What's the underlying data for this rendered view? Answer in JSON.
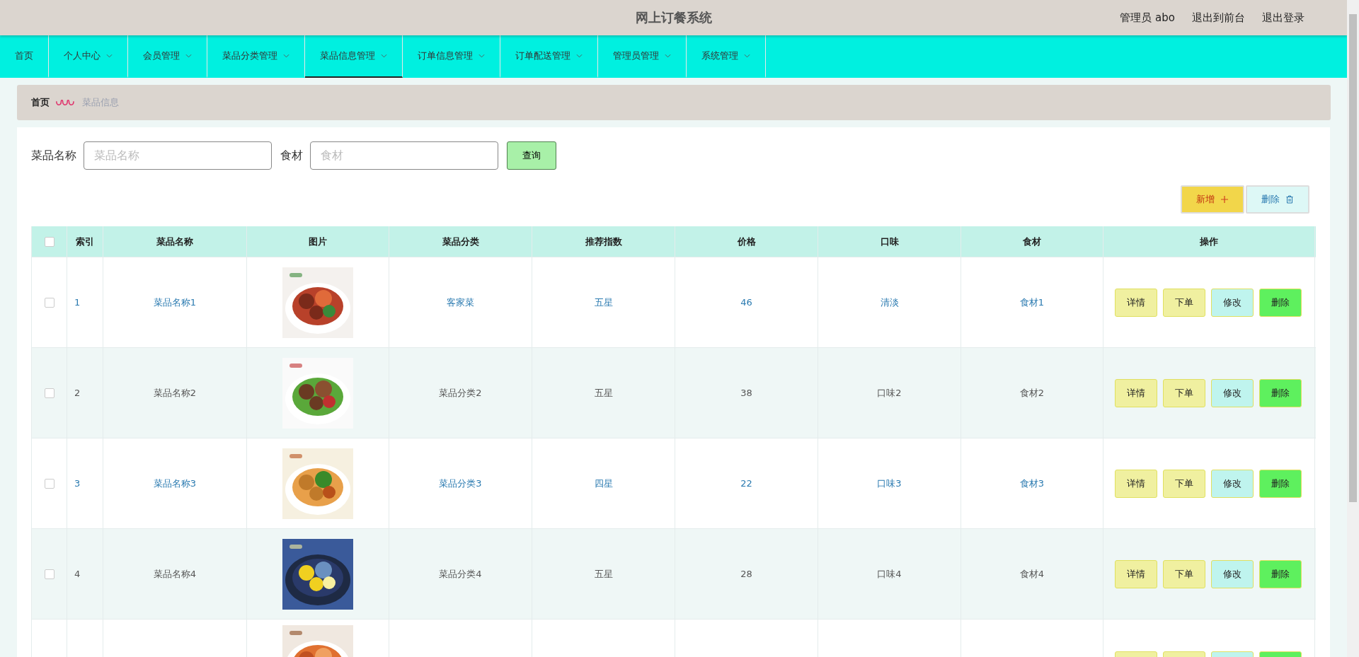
{
  "header": {
    "title": "网上订餐系统",
    "user": "管理员 abo",
    "links": [
      "退出到前台",
      "退出登录"
    ]
  },
  "nav": [
    {
      "label": "首页",
      "has_menu": false,
      "selected": false
    },
    {
      "label": "个人中心",
      "has_menu": true,
      "selected": false
    },
    {
      "label": "会员管理",
      "has_menu": true,
      "selected": false
    },
    {
      "label": "菜品分类管理",
      "has_menu": true,
      "selected": false
    },
    {
      "label": "菜品信息管理",
      "has_menu": true,
      "selected": true
    },
    {
      "label": "订单信息管理",
      "has_menu": true,
      "selected": false
    },
    {
      "label": "订单配送管理",
      "has_menu": true,
      "selected": false
    },
    {
      "label": "管理员管理",
      "has_menu": true,
      "selected": false
    },
    {
      "label": "系统管理",
      "has_menu": true,
      "selected": false
    }
  ],
  "breadcrumb": [
    "首页",
    "菜品信息"
  ],
  "search": {
    "fields": [
      {
        "label": "菜品名称",
        "placeholder": "菜品名称"
      },
      {
        "label": "食材",
        "placeholder": "食材"
      }
    ],
    "button": "查询"
  },
  "toolbar": [
    {
      "label": "新增",
      "kind": "add"
    },
    {
      "label": "删除",
      "kind": "delete"
    }
  ],
  "table": {
    "header_checkbox": {
      "checked": false
    },
    "columns": [
      "索引",
      "菜品名称",
      "图片",
      "菜品分类",
      "推荐指数",
      "价格",
      "口味",
      "食材",
      "操作"
    ],
    "rows": [
      {
        "checked": false,
        "index": "1",
        "name": "菜品名称1",
        "category": "客家菜",
        "rating": "五星",
        "price": "46",
        "taste": "清淡",
        "ingredient": "食材1",
        "actions": [
          {
            "label": "详情",
            "kind": "detail"
          },
          {
            "label": "下单",
            "kind": "order"
          },
          {
            "label": "修改",
            "kind": "edit"
          },
          {
            "label": "删除",
            "kind": "delete"
          }
        ]
      },
      {
        "checked": false,
        "index": "2",
        "name": "菜品名称2",
        "category": "菜品分类2",
        "rating": "五星",
        "price": "38",
        "taste": "口味2",
        "ingredient": "食材2",
        "actions": [
          {
            "label": "详情",
            "kind": "detail"
          },
          {
            "label": "下单",
            "kind": "order"
          },
          {
            "label": "修改",
            "kind": "edit"
          },
          {
            "label": "删除",
            "kind": "delete"
          }
        ]
      },
      {
        "checked": false,
        "index": "3",
        "name": "菜品名称3",
        "category": "菜品分类3",
        "rating": "四星",
        "price": "22",
        "taste": "口味3",
        "ingredient": "食材3",
        "actions": [
          {
            "label": "详情",
            "kind": "detail"
          },
          {
            "label": "下单",
            "kind": "order"
          },
          {
            "label": "修改",
            "kind": "edit"
          },
          {
            "label": "删除",
            "kind": "delete"
          }
        ]
      },
      {
        "checked": false,
        "index": "4",
        "name": "菜品名称4",
        "category": "菜品分类4",
        "rating": "五星",
        "price": "28",
        "taste": "口味4",
        "ingredient": "食材4",
        "actions": [
          {
            "label": "详情",
            "kind": "detail"
          },
          {
            "label": "下单",
            "kind": "order"
          },
          {
            "label": "修改",
            "kind": "edit"
          },
          {
            "label": "删除",
            "kind": "delete"
          }
        ]
      }
    ],
    "partial_row": {
      "actions": [
        {
          "kind": "detail"
        },
        {
          "kind": "order"
        },
        {
          "kind": "edit"
        },
        {
          "kind": "delete"
        }
      ]
    }
  }
}
